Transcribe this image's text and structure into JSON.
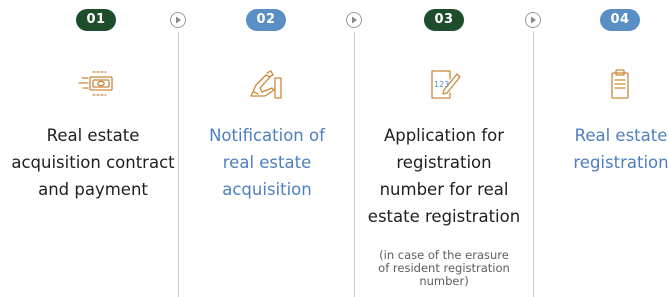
{
  "colors": {
    "dark_green": "#1e4d2b",
    "blue": "#5a8fc6",
    "orange": "#c98a3c",
    "text_dark": "#1f1f1f",
    "text_blue": "#4d7fbf",
    "divider": "#c9c9c9"
  },
  "steps": [
    {
      "number": "01",
      "title_lines": [
        "Real estate",
        "acquisition contract",
        "and payment"
      ],
      "icon": "money-bill-icon",
      "accent": "dark_green",
      "title_color": "text_dark"
    },
    {
      "number": "02",
      "title_lines": [
        "Notification of",
        "real estate",
        "acquisition"
      ],
      "icon": "hand-writing-icon",
      "accent": "blue",
      "title_color": "text_blue"
    },
    {
      "number": "03",
      "title_lines": [
        "Application for",
        "registration",
        "number for real",
        "estate registration"
      ],
      "note_lines": [
        "(in case of the erasure",
        "of resident registration",
        "number)"
      ],
      "icon": "number-form-icon",
      "accent": "dark_green",
      "title_color": "text_dark"
    },
    {
      "number": "04",
      "title_lines": [
        "Real estate",
        "registration"
      ],
      "icon": "clipboard-icon",
      "accent": "blue",
      "title_color": "text_blue"
    }
  ],
  "icons": {
    "arrow": "play-arrow-icon"
  }
}
